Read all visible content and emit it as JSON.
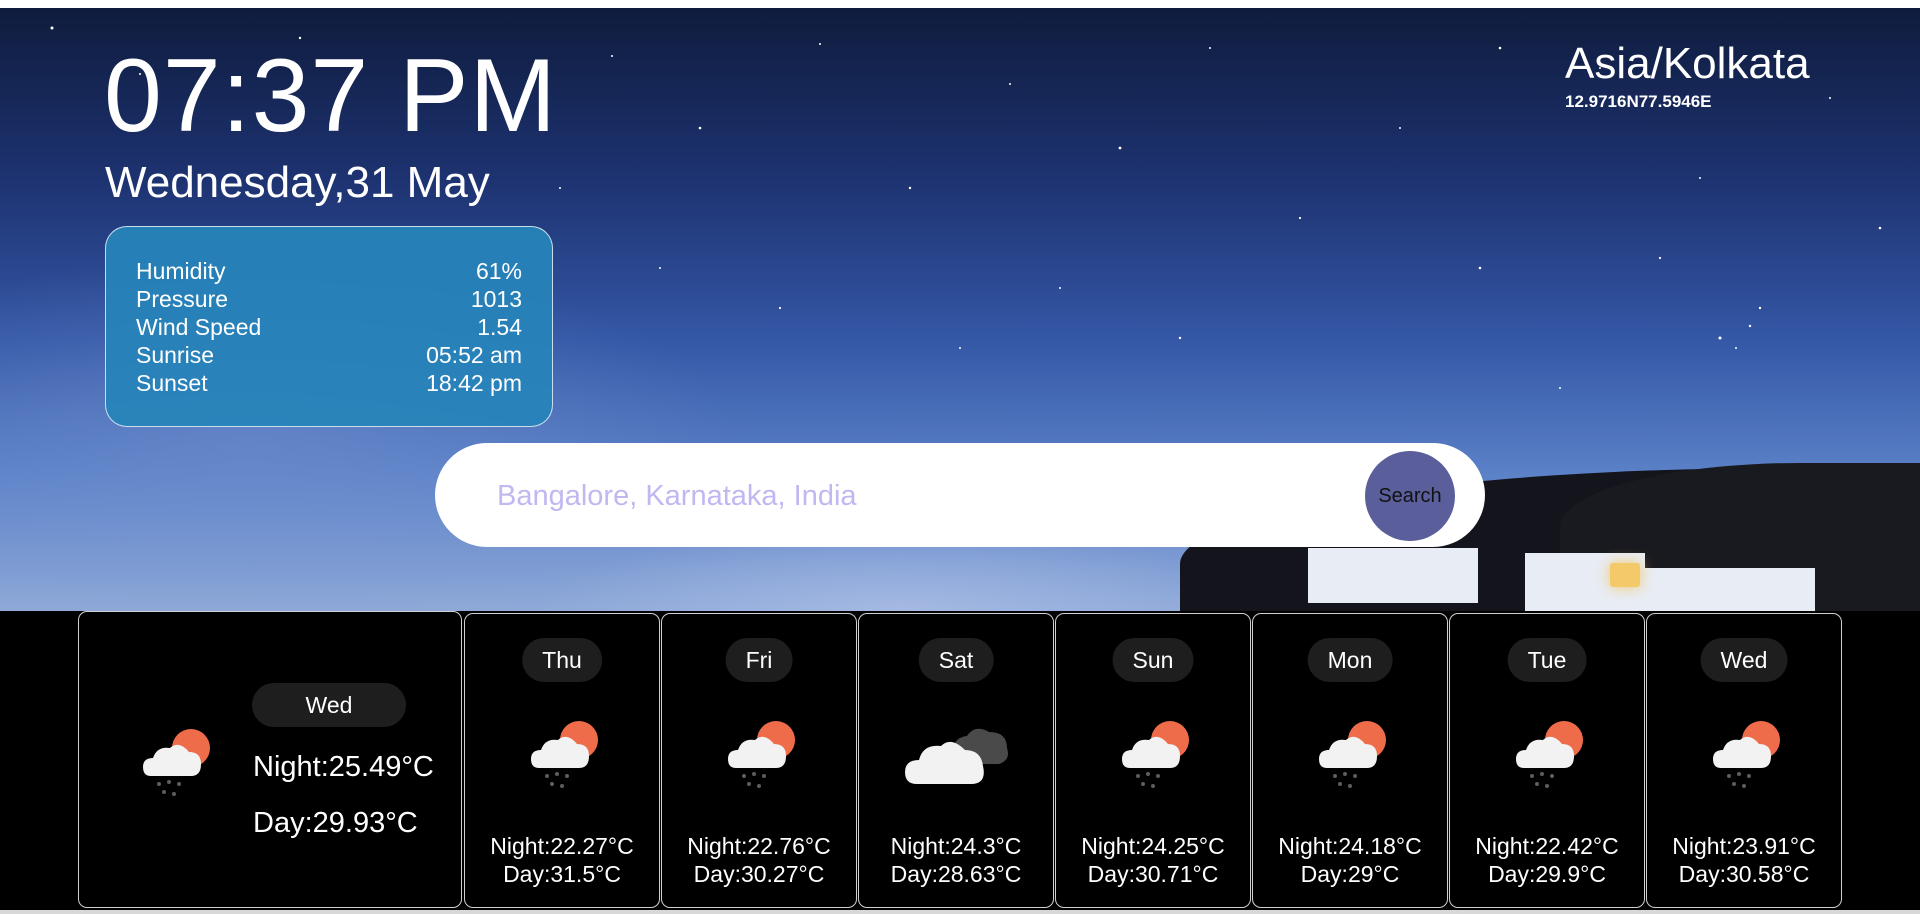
{
  "header": {
    "time": "07:37 PM",
    "date": "Wednesday,31 May",
    "timezone": "Asia/Kolkata",
    "coordinates": "12.9716N77.5946E"
  },
  "details": [
    {
      "label": "Humidity",
      "value": "61%"
    },
    {
      "label": "Pressure",
      "value": "1013"
    },
    {
      "label": "Wind Speed",
      "value": "1.54"
    },
    {
      "label": "Sunrise",
      "value": "05:52 am"
    },
    {
      "label": "Sunset",
      "value": "18:42 pm"
    }
  ],
  "search": {
    "placeholder": "Bangalore, Karnataka, India",
    "button_label": "Search"
  },
  "today": {
    "day": "Wed",
    "night": "Night:25.49°C",
    "daytime": "Day:29.93°C",
    "icon": "rain-cloud-sun-icon"
  },
  "forecast": [
    {
      "day": "Thu",
      "night": "Night:22.27°C",
      "daytime": "Day:31.5°C",
      "icon": "rain-cloud-sun-icon"
    },
    {
      "day": "Fri",
      "night": "Night:22.76°C",
      "daytime": "Day:30.27°C",
      "icon": "rain-cloud-sun-icon"
    },
    {
      "day": "Sat",
      "night": "Night:24.3°C",
      "daytime": "Day:28.63°C",
      "icon": "overcast-clouds-icon"
    },
    {
      "day": "Sun",
      "night": "Night:24.25°C",
      "daytime": "Day:30.71°C",
      "icon": "rain-cloud-sun-icon"
    },
    {
      "day": "Mon",
      "night": "Night:24.18°C",
      "daytime": "Day:29°C",
      "icon": "rain-cloud-sun-icon"
    },
    {
      "day": "Tue",
      "night": "Night:22.42°C",
      "daytime": "Day:29.9°C",
      "icon": "rain-cloud-sun-icon"
    },
    {
      "day": "Wed",
      "night": "Night:23.91°C",
      "daytime": "Day:30.58°C",
      "icon": "rain-cloud-sun-icon"
    }
  ],
  "colors": {
    "info_card": "#2684ba",
    "search_button": "#5a5f9c",
    "placeholder": "#c0b8f0",
    "sun": "#ef6c4a",
    "day_pill": "#1e1e1e"
  }
}
